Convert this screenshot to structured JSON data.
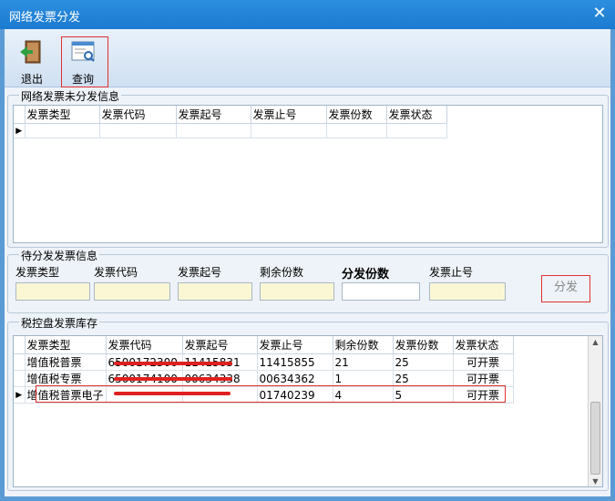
{
  "window": {
    "title": "网络发票分发"
  },
  "toolbar": {
    "exit_label": "退出",
    "query_label": "查询"
  },
  "undistributed": {
    "title": "网络发票未分发信息",
    "columns": [
      "发票类型",
      "发票代码",
      "发票起号",
      "发票止号",
      "发票份数",
      "发票状态"
    ]
  },
  "pending": {
    "title": "待分发发票信息",
    "labels": {
      "type": "发票类型",
      "code": "发票代码",
      "start": "发票起号",
      "remaining": "剩余份数",
      "count": "分发份数",
      "end": "发票止号"
    },
    "values": {
      "type": "",
      "code": "",
      "start": "",
      "remaining": "",
      "count": "",
      "end": ""
    },
    "distribute_label": "分发"
  },
  "inventory": {
    "title": "税控盘发票库存",
    "columns": [
      "发票类型",
      "发票代码",
      "发票起号",
      "发票止号",
      "剩余份数",
      "发票份数",
      "发票状态"
    ],
    "rows": [
      {
        "type": "增值税普票",
        "code": "6500172300",
        "start": "11415831",
        "end": "11415855",
        "remaining": "21",
        "count": "25",
        "status": "可开票"
      },
      {
        "type": "增值税专票",
        "code": "6500174100",
        "start": "00634338",
        "end": "00634362",
        "remaining": "1",
        "count": "25",
        "status": "可开票"
      },
      {
        "type": "增值税普票电子",
        "code": "",
        "start": "",
        "end": "01740239",
        "remaining": "4",
        "count": "5",
        "status": "可开票"
      }
    ]
  }
}
